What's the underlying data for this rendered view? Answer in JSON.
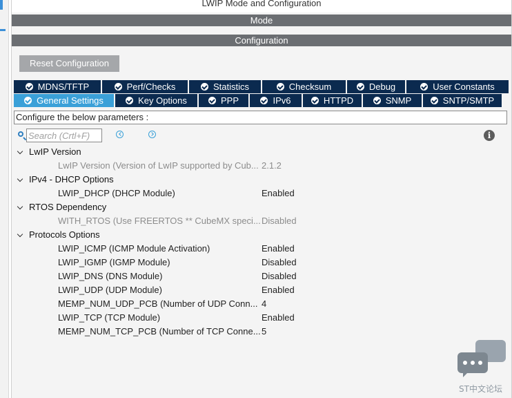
{
  "window": {
    "title": "LWIP Mode and Configuration"
  },
  "sections": {
    "mode": "Mode",
    "configuration": "Configuration"
  },
  "toolbar": {
    "reset_label": "Reset Configuration"
  },
  "tabs_row1": [
    {
      "label": "MDNS/TFTP"
    },
    {
      "label": "Perf/Checks"
    },
    {
      "label": "Statistics"
    },
    {
      "label": "Checksum"
    },
    {
      "label": "Debug"
    },
    {
      "label": "User Constants"
    }
  ],
  "tabs_row2": [
    {
      "label": "General Settings",
      "active": true
    },
    {
      "label": "Key Options"
    },
    {
      "label": "PPP"
    },
    {
      "label": "IPv6"
    },
    {
      "label": "HTTPD"
    },
    {
      "label": "SNMP"
    },
    {
      "label": "SNTP/SMTP"
    }
  ],
  "params_hint": "Configure the below parameters :",
  "search": {
    "placeholder": "Search (Crtl+F)"
  },
  "tree": [
    {
      "group": "LwIP Version",
      "params": [
        {
          "name": "LwIP Version (Version of LwIP supported by Cub...",
          "value": "2.1.2",
          "disabled": true
        }
      ]
    },
    {
      "group": "IPv4 - DHCP Options",
      "params": [
        {
          "name": "LWIP_DHCP (DHCP Module)",
          "value": "Enabled"
        }
      ]
    },
    {
      "group": "RTOS Dependency",
      "params": [
        {
          "name": "WITH_RTOS (Use FREERTOS ** CubeMX speci...",
          "value": "Disabled",
          "disabled": true
        }
      ]
    },
    {
      "group": "Protocols Options",
      "params": [
        {
          "name": "LWIP_ICMP (ICMP Module Activation)",
          "value": "Enabled"
        },
        {
          "name": "LWIP_IGMP (IGMP Module)",
          "value": "Disabled"
        },
        {
          "name": "LWIP_DNS (DNS Module)",
          "value": "Disabled"
        },
        {
          "name": "LWIP_UDP (UDP Module)",
          "value": "Enabled"
        },
        {
          "name": "MEMP_NUM_UDP_PCB (Number of UDP Conn...",
          "value": "4"
        },
        {
          "name": "LWIP_TCP (TCP Module)",
          "value": "Enabled"
        },
        {
          "name": "MEMP_NUM_TCP_PCB (Number of TCP Conne...",
          "value": "5"
        }
      ]
    }
  ],
  "watermark": {
    "text": "ST中文论坛"
  },
  "colors": {
    "tab": "#0b2a4f",
    "tab_active": "#3aa0d8",
    "bar": "#6b6e72",
    "button": "#a5a7aa"
  }
}
